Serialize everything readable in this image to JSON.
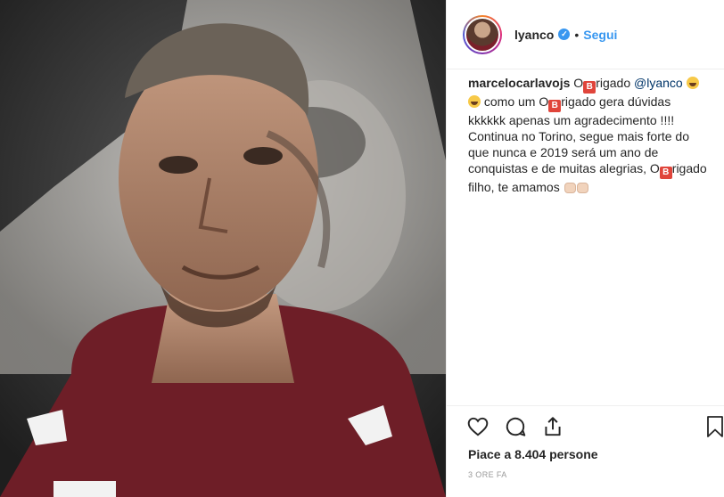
{
  "post": {
    "username": "lyanco",
    "verified_mark": "✓",
    "separator": "•",
    "follow_label": "Segui",
    "image_alt": "Foto del post"
  },
  "comment": {
    "author": "marcelocarlavojs",
    "b_emoji": "B",
    "part1": " O",
    "part2": "rigado ",
    "mention": "@lyanco",
    "part3": " como um O",
    "part4": "rigado gera dúvidas kkkkkk apenas um agradecimento !!!! Continua no Torino, segue mais forte do que nunca e 2019 será um ano de conquistas e de muitas alegrias, O",
    "part5": "rigado filho, te amamos"
  },
  "footer": {
    "likes": "Piace a 8.404 persone",
    "time": "3 ORE FA"
  },
  "icons": [
    "heart-icon",
    "comment-icon",
    "share-icon",
    "bookmark-icon",
    "verified-icon"
  ],
  "colors": {
    "accent": "#3897f0",
    "jersey": "#6e1e27",
    "text": "#262626",
    "muted": "#999999"
  }
}
